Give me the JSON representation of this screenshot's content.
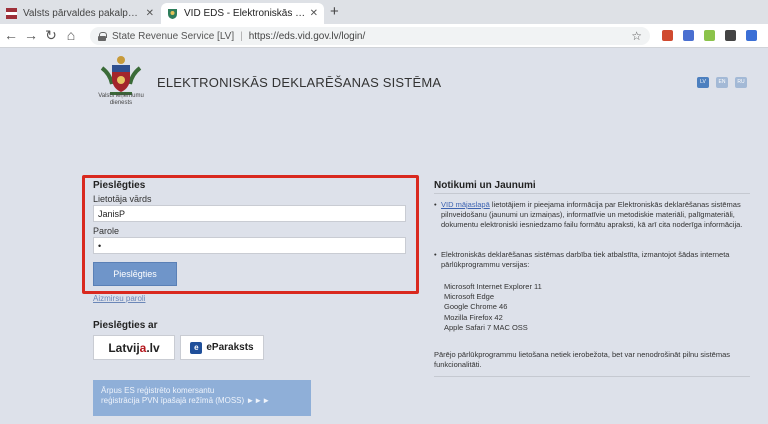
{
  "browser": {
    "tabs": [
      {
        "title": "Valsts pārvaldes pakalpojumu po",
        "favicon": "latvia-flag-icon"
      },
      {
        "title": "VID EDS - Elektroniskās deklarēšan",
        "favicon": "coat-of-arms-icon"
      }
    ],
    "address": {
      "organization": "State Revenue Service [LV]",
      "url": "https://eds.vid.gov.lv/login/"
    }
  },
  "header": {
    "logo_caption": "Valsts ieņēmumu dienests",
    "title": "ELEKTRONISKĀS DEKLARĒŠANAS SISTĒMA",
    "languages": [
      {
        "label": "LV",
        "active": true
      },
      {
        "label": "EN",
        "active": false
      },
      {
        "label": "RU",
        "active": false
      }
    ]
  },
  "login": {
    "title": "Pieslēgties",
    "username_label": "Lietotāja vārds",
    "username_value": "JanisP",
    "password_label": "Parole",
    "password_value": "•",
    "submit_label": "Pieslēgties",
    "forgot_label": "Aizmirsu paroli"
  },
  "alt_login": {
    "title": "Pieslēgties ar",
    "latvija_prefix": "Latvij",
    "latvija_highlight": "a",
    "latvija_suffix": ".lv",
    "eparaksts_label": "eParaksts",
    "moss_line1": "Ārpus ES reģistrēto komersantu",
    "moss_line2": "reģistrācija PVN īpašajā režīmā (MOSS) ►►►"
  },
  "news": {
    "title": "Notikumi un Jaunumi",
    "item1_link": "VID mājaslapā",
    "item1_text": " lietotājiem ir pieejama informācija par Elektroniskās deklarēšanas sistēmas pilnveidošanu (jaunumi un izmaiņas), informatīvie un metodiskie materiāli, palīgmateriāli, dokumentu elektroniski iesniedzamo failu formātu apraksti, kā arī cita noderīga informācija.",
    "item2_text": "Elektroniskās deklarēšanas sistēmas darbība tiek atbalstīta, izmantojot šādas interneta pārlūkprogrammu versijas:",
    "browsers": [
      "Microsoft Internet Explorer 11",
      "Microsoft Edge",
      "Google Chrome 46",
      "Mozilla Firefox 42",
      "Apple Safari 7 MAC OSS"
    ],
    "footer": "Pārējo pārlūkprogrammu lietošana netiek ierobežota, bet var nenodrošināt pilnu sistēmas funkcionalitāti."
  },
  "colors": {
    "accent": "#6f95c9",
    "highlight_border": "#d9291f",
    "page_bg": "#dde1ea"
  }
}
